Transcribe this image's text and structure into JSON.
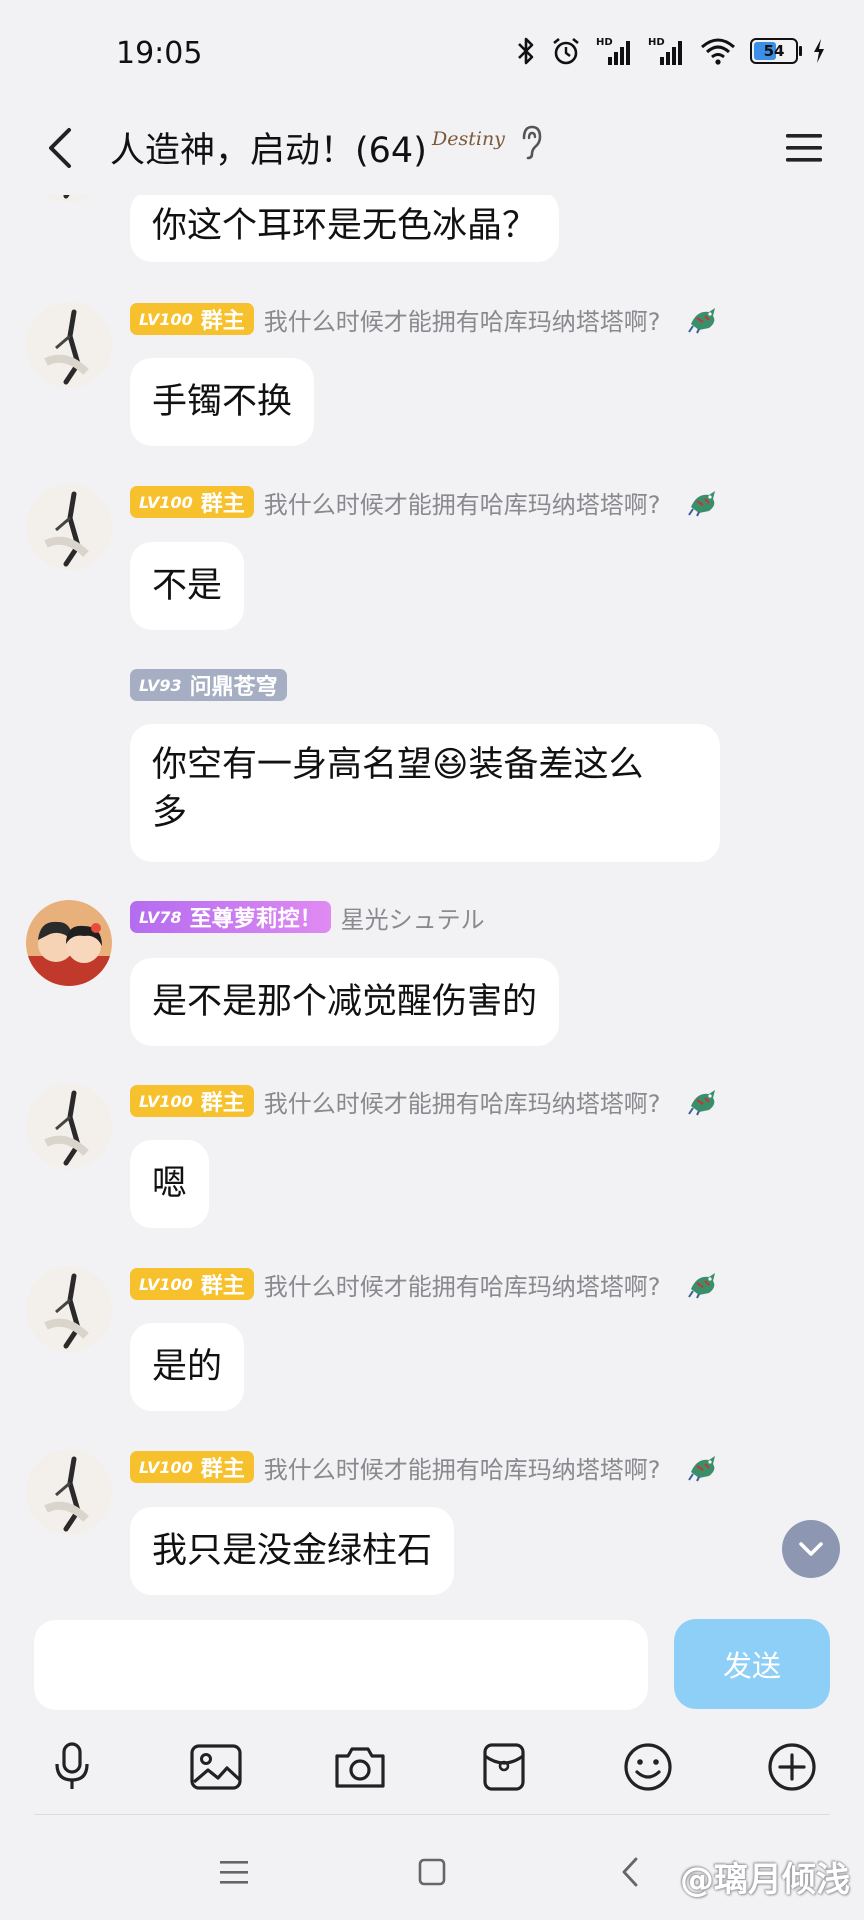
{
  "status": {
    "time": "19:05",
    "battery": "54",
    "battery_level": 0.54,
    "net1": "HD",
    "net2": "HD"
  },
  "header": {
    "title": "人造神，启动！(64)",
    "badge": "Destiny"
  },
  "messages": [
    {
      "text": "你这个耳环是无色冰晶？"
    },
    {
      "level": "LV100",
      "role": "群主",
      "nick": "我什么时候才能拥有哈库玛纳塔塔啊?",
      "text": "手镯不换"
    },
    {
      "level": "LV100",
      "role": "群主",
      "nick": "我什么时候才能拥有哈库玛纳塔塔啊?",
      "text": "不是"
    },
    {
      "level": "LV93",
      "role": "问鼎苍穹",
      "text_line1": "你空有一身高名望😆装备差这么",
      "text_line2": "多"
    },
    {
      "level": "LV78",
      "role": "至尊萝莉控！",
      "nick": "星光シュテル",
      "text": "是不是那个减觉醒伤害的"
    },
    {
      "level": "LV100",
      "role": "群主",
      "nick": "我什么时候才能拥有哈库玛纳塔塔啊?",
      "text": "嗯"
    },
    {
      "level": "LV100",
      "role": "群主",
      "nick": "我什么时候才能拥有哈库玛纳塔塔啊?",
      "text": "是的"
    },
    {
      "level": "LV100",
      "role": "群主",
      "nick": "我什么时候才能拥有哈库玛纳塔塔啊?",
      "text": "我只是没金绿柱石"
    }
  ],
  "input": {
    "placeholder": "",
    "send_label": "发送"
  },
  "watermark": "@璃月倾浅",
  "colors": {
    "background": "#f2f2f5",
    "gold_badge": "#f7c12e",
    "grey_badge": "#a6aec3",
    "pink_badge": "#c77cf2",
    "send": "#8ecff7"
  },
  "icons": [
    "back-icon",
    "menu-icon",
    "ear-icon",
    "mic-icon",
    "image-icon",
    "camera-icon",
    "red-packet-icon",
    "emoji-icon",
    "plus-icon",
    "scroll-down-icon",
    "dragon-icon"
  ]
}
